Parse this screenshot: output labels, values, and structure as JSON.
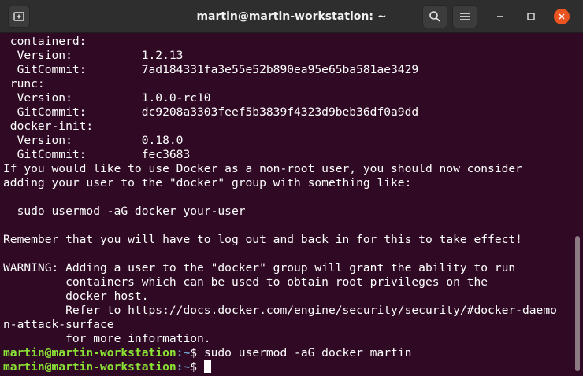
{
  "window": {
    "title": "martin@martin-workstation: ~"
  },
  "titlebar": {
    "new_tab_icon": "new-tab-icon",
    "search_icon": "search-icon",
    "menu_icon": "hamburger-menu-icon",
    "minimize_icon": "minimize-icon",
    "maximize_icon": "maximize-icon",
    "close_icon": "close-icon"
  },
  "terminal": {
    "output": [
      " containerd:",
      "  Version:          1.2.13",
      "  GitCommit:        7ad184331fa3e55e52b890ea95e65ba581ae3429",
      " runc:",
      "  Version:          1.0.0-rc10",
      "  GitCommit:        dc9208a3303feef5b3839f4323d9beb36df0a9dd",
      " docker-init:",
      "  Version:          0.18.0",
      "  GitCommit:        fec3683",
      "If you would like to use Docker as a non-root user, you should now consider",
      "adding your user to the \"docker\" group with something like:",
      "",
      "  sudo usermod -aG docker your-user",
      "",
      "Remember that you will have to log out and back in for this to take effect!",
      "",
      "WARNING: Adding a user to the \"docker\" group will grant the ability to run",
      "         containers which can be used to obtain root privileges on the",
      "         docker host.",
      "         Refer to https://docs.docker.com/engine/security/security/#docker-daemo",
      "n-attack-surface",
      "         for more information."
    ],
    "prompts": [
      {
        "user": "martin@martin-workstation",
        "path": ":~",
        "symbol": "$ ",
        "command": "sudo usermod -aG docker martin"
      },
      {
        "user": "martin@martin-workstation",
        "path": ":~",
        "symbol": "$ ",
        "command": ""
      }
    ]
  },
  "colors": {
    "background": "#300a24",
    "prompt_user": "#8ae234",
    "prompt_path": "#729fcf",
    "close_button": "#e95420"
  }
}
